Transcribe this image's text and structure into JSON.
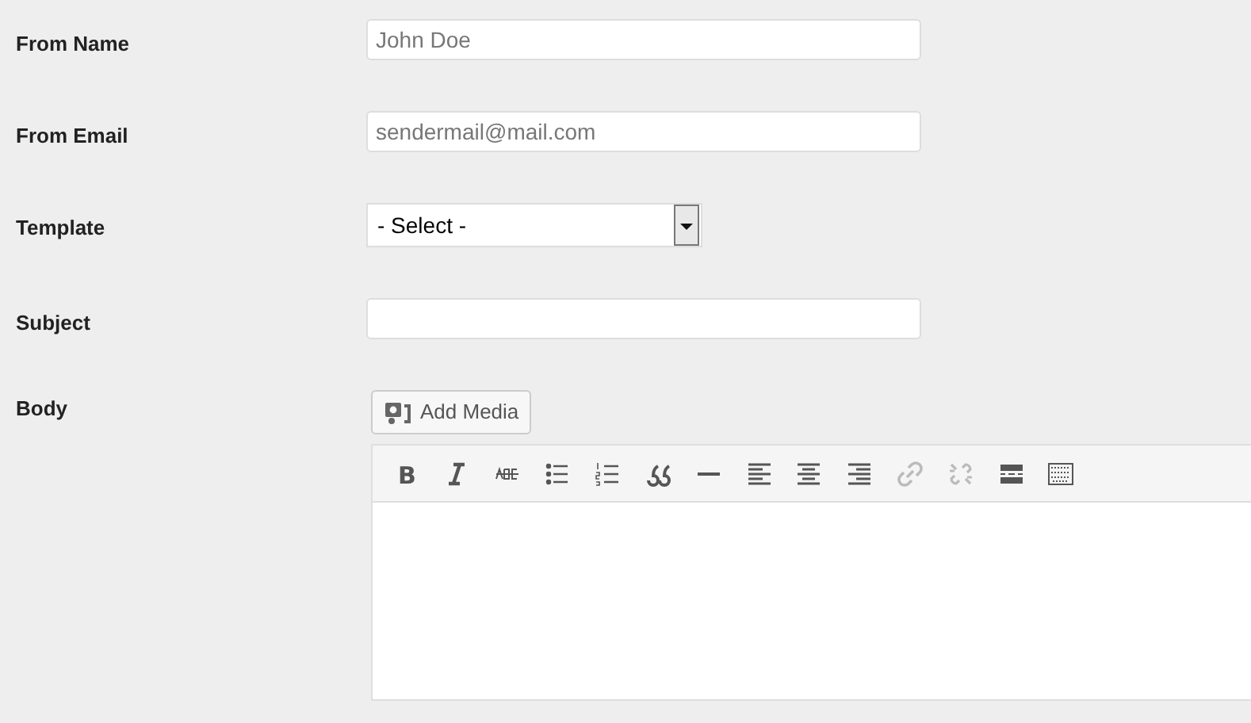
{
  "fields": [
    {
      "label": "From Name",
      "kind": "text",
      "placeholder": "John Doe"
    },
    {
      "label": "From Email",
      "kind": "text",
      "placeholder": "sendermail@mail.com"
    },
    {
      "label": "Template",
      "kind": "select",
      "value": "- Select -"
    },
    {
      "label": "Subject",
      "kind": "text"
    }
  ],
  "body": {
    "label": "Body",
    "add_media": "Add Media",
    "tools": [
      {
        "kind": "bold",
        "label": "B",
        "disabled": false
      },
      {
        "kind": "italic",
        "disabled": false
      },
      {
        "kind": "strikethrough",
        "disabled": false
      },
      {
        "kind": "bullets",
        "disabled": false
      },
      {
        "kind": "numbers",
        "disabled": false
      },
      {
        "kind": "quote",
        "disabled": false
      },
      {
        "kind": "hr",
        "disabled": false
      },
      {
        "kind": "alignleft",
        "disabled": false
      },
      {
        "kind": "aligncenter",
        "disabled": false
      },
      {
        "kind": "alignright",
        "disabled": false
      },
      {
        "kind": "link",
        "disabled": true
      },
      {
        "kind": "unlink",
        "disabled": true
      },
      {
        "kind": "more",
        "disabled": false
      },
      {
        "kind": "kitchen",
        "disabled": false
      }
    ]
  }
}
